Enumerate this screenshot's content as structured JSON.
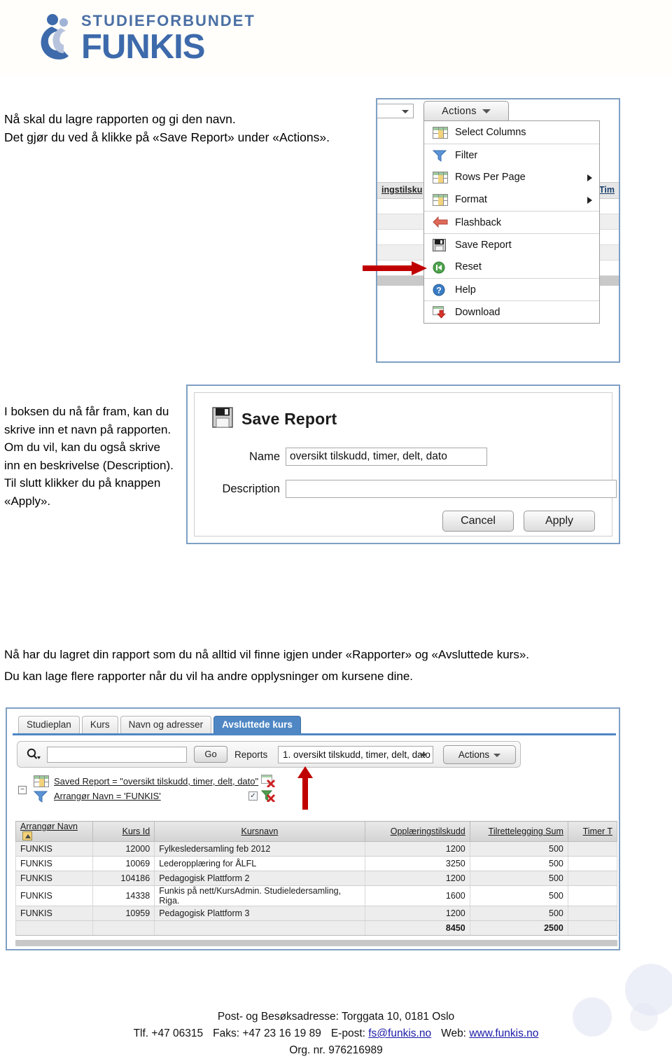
{
  "brand": {
    "logo_line1": "STUDIEFORBUNDET",
    "logo_line2": "FUNKIS",
    "logo_icon": "funkis-figure-icon",
    "accent_blue": "#3d6aab",
    "light_blue": "#4a6fa5"
  },
  "instructions": {
    "step1": "Nå skal du lagre rapporten og gi den navn.\nDet gjør du ved å klikke på «Save Report» under «Actions».",
    "step2": "I boksen du nå får fram, kan du skrive inn et navn på rapporten. Om du vil, kan du også skrive inn en beskrivelse (Description). Til slutt klikker du på knappen «Apply».",
    "step3": "Nå har du lagret din rapport som du nå alltid vil finne igjen under «Rapporter» og «Avsluttede kurs».\nDu kan lage flere rapporter når du vil ha andre opplysninger om kursene dine."
  },
  "actions_menu_shot": {
    "combo_value": "",
    "actions_button": "Actions",
    "partial_column_header": "ingstilsku",
    "partial_column_header_right": "Tim",
    "items": [
      {
        "label": "Select Columns",
        "icon": "grid-icon",
        "submenu": false
      },
      {
        "label": "Filter",
        "icon": "funnel-icon",
        "submenu": false
      },
      {
        "label": "Rows Per Page",
        "icon": "grid-icon",
        "submenu": true
      },
      {
        "label": "Format",
        "icon": "grid-icon",
        "submenu": true
      },
      {
        "label": "Flashback",
        "icon": "flashback-arrow-icon",
        "submenu": false
      },
      {
        "label": "Save Report",
        "icon": "floppy-disk-icon",
        "submenu": false
      },
      {
        "label": "Reset",
        "icon": "reset-icon",
        "submenu": false
      },
      {
        "label": "Help",
        "icon": "help-question-icon",
        "submenu": false
      },
      {
        "label": "Download",
        "icon": "download-icon",
        "submenu": false
      }
    ],
    "pointer_arrow": "red-arrow-right-icon"
  },
  "save_report_dialog": {
    "title": "Save Report",
    "title_icon": "floppy-disk-icon",
    "name_label": "Name",
    "name_value": "oversikt tilskudd, timer, delt, dato",
    "name_placeholder": "",
    "description_label": "Description",
    "description_value": "",
    "description_placeholder": "",
    "cancel_label": "Cancel",
    "apply_label": "Apply"
  },
  "report_shot": {
    "tabs": [
      {
        "label": "Studieplan",
        "active": false
      },
      {
        "label": "Kurs",
        "active": false
      },
      {
        "label": "Navn og adresser",
        "active": false
      },
      {
        "label": "Avsluttede kurs",
        "active": true
      }
    ],
    "search": {
      "icon": "magnifier-dropdown-icon",
      "value": "",
      "placeholder": "",
      "go_label": "Go"
    },
    "reports_label": "Reports",
    "reports_selected": "1. oversikt tilskudd, timer, delt, dato",
    "actions_button": "Actions",
    "pointer_arrow": "red-arrow-up-icon",
    "filters": [
      {
        "icon": "grid-icon",
        "text": "Saved Report = \"oversikt tilskudd, timer, delt, dato\"",
        "has_checkbox": false,
        "checked": false,
        "remove_icon": "grid-remove-icon"
      },
      {
        "icon": "funnel-icon",
        "text": "Arrangør Navn = 'FUNKIS'",
        "has_checkbox": true,
        "checked": true,
        "remove_icon": "funnel-remove-icon"
      }
    ],
    "collapse_toggle": "−"
  },
  "table": {
    "columns": [
      {
        "label": "Arrangør Navn",
        "sorted": true,
        "align": "left"
      },
      {
        "label": "Kurs Id",
        "sorted": false,
        "align": "right"
      },
      {
        "label": "Kursnavn",
        "sorted": false,
        "align": "left"
      },
      {
        "label": "Opplæringstilskudd",
        "sorted": false,
        "align": "right"
      },
      {
        "label": "Tilrettelegging Sum",
        "sorted": false,
        "align": "right"
      },
      {
        "label": "Timer T",
        "sorted": false,
        "align": "right"
      }
    ],
    "rows": [
      [
        "FUNKIS",
        "12000",
        "Fylkesledersamling feb 2012",
        "1200",
        "500",
        ""
      ],
      [
        "FUNKIS",
        "10069",
        "Lederopplæring for ÅLFL",
        "3250",
        "500",
        ""
      ],
      [
        "FUNKIS",
        "104186",
        "Pedagogisk Plattform 2",
        "1200",
        "500",
        ""
      ],
      [
        "FUNKIS",
        "14338",
        "Funkis på nett/KursAdmin. Studieledersamling, Riga.",
        "1600",
        "500",
        ""
      ],
      [
        "FUNKIS",
        "10959",
        "Pedagogisk Plattform 3",
        "1200",
        "500",
        ""
      ]
    ],
    "totals": [
      "",
      "",
      "",
      "8450",
      "2500",
      ""
    ]
  },
  "footer": {
    "line1": "Post- og  Besøksadresse: Torggata 10, 0181 Oslo",
    "tlf": "Tlf. +47 06315",
    "faks": "Faks: +47 23 16 19 89",
    "epost_label": "E-post:",
    "epost": "fs@funkis.no",
    "web_label": "Web:",
    "web": "www.funkis.no",
    "orgnr": "Org. nr. 976216989"
  }
}
